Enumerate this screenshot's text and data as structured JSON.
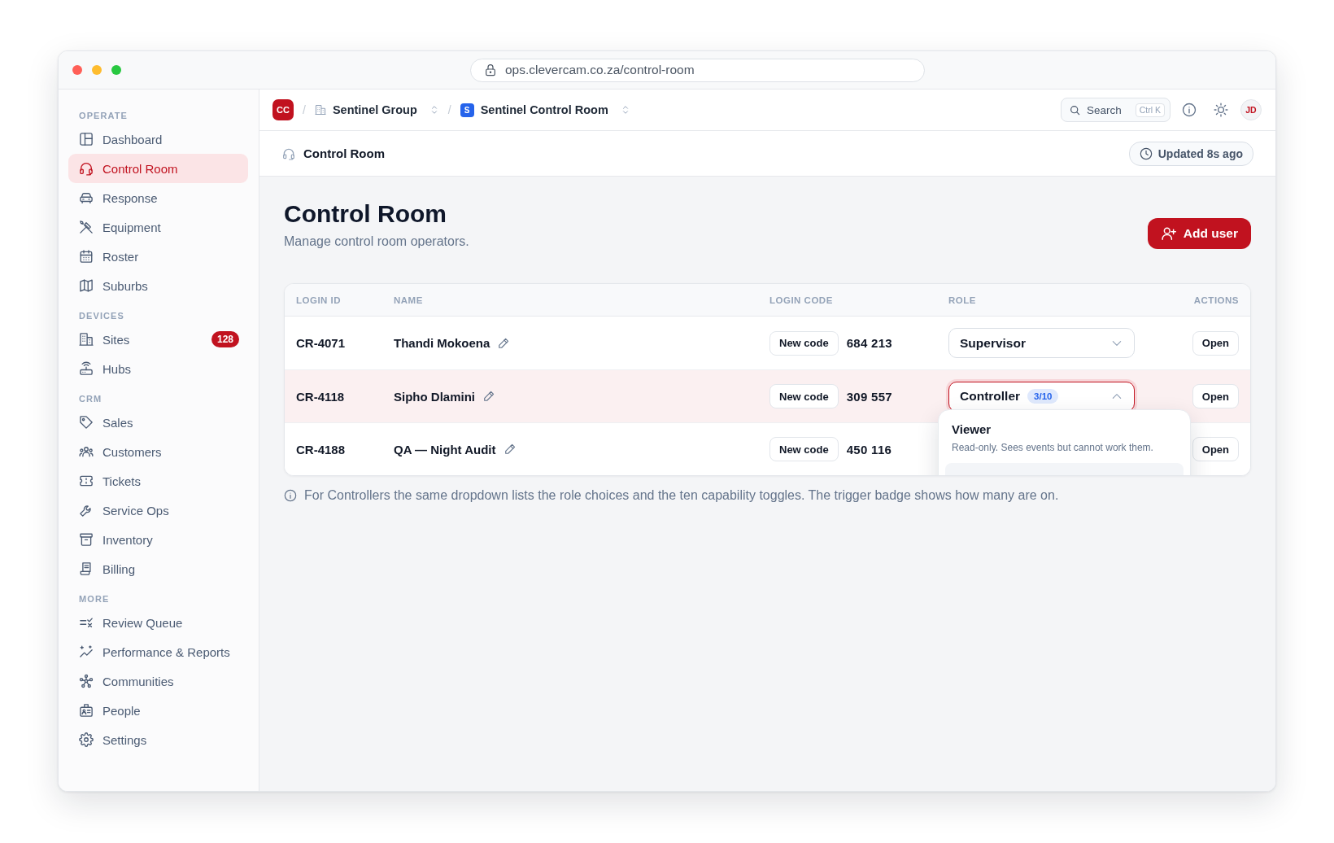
{
  "window": {
    "url": "ops.clevercam.co.za/control-room"
  },
  "sidebar": {
    "sections": [
      {
        "label": "OPERATE",
        "items": [
          {
            "label": "Dashboard",
            "selected": false
          },
          {
            "label": "Control Room",
            "selected": true
          },
          {
            "label": "Response",
            "selected": false
          },
          {
            "label": "Equipment",
            "selected": false
          },
          {
            "label": "Roster",
            "selected": false
          },
          {
            "label": "Suburbs",
            "selected": false
          }
        ]
      },
      {
        "label": "DEVICES",
        "items": [
          {
            "label": "Sites",
            "selected": false,
            "badge": "128"
          },
          {
            "label": "Hubs",
            "selected": false
          }
        ]
      },
      {
        "label": "CRM",
        "items": [
          {
            "label": "Sales",
            "selected": false
          },
          {
            "label": "Customers",
            "selected": false
          },
          {
            "label": "Tickets",
            "selected": false
          },
          {
            "label": "Service Ops",
            "selected": false
          },
          {
            "label": "Inventory",
            "selected": false
          },
          {
            "label": "Billing",
            "selected": false
          }
        ]
      },
      {
        "label": "MORE",
        "items": [
          {
            "label": "Review Queue",
            "selected": false
          },
          {
            "label": "Performance & Reports",
            "selected": false
          },
          {
            "label": "Communities",
            "selected": false
          },
          {
            "label": "People",
            "selected": false
          },
          {
            "label": "Settings",
            "selected": false
          }
        ]
      }
    ]
  },
  "topbar": {
    "org_badge": "CC",
    "breadcrumbs": [
      {
        "separator": "/",
        "label": "Sentinel Group"
      },
      {
        "separator": "/",
        "badge": "S",
        "label": "Sentinel Control Room"
      }
    ],
    "search": {
      "placeholder": "Search",
      "shortcut": "Ctrl K"
    },
    "avatar": "JD"
  },
  "header": {
    "title": "Control Room",
    "updated": "Updated 8s ago"
  },
  "page": {
    "title": "Control Room",
    "subtitle": "Manage control room operators.",
    "add_button": "Add user"
  },
  "table": {
    "columns": [
      "LOGIN ID",
      "NAME",
      "LOGIN CODE",
      "ROLE",
      "ACTIONS"
    ],
    "rows": [
      {
        "login_id": "CR-4071",
        "name": "Thandi Mokoena",
        "new_code": "New code",
        "login_code": "684 213",
        "role": "Supervisor",
        "expanded": false,
        "selected": false,
        "action": "Open"
      },
      {
        "login_id": "CR-4118",
        "name": "Sipho Dlamini",
        "new_code": "New code",
        "login_code": "309 557",
        "role": "Controller",
        "role_badge": "3/10",
        "expanded": true,
        "selected": true,
        "action": "Open",
        "menu": {
          "options": [
            {
              "label": "Viewer",
              "description": "Read-only. Sees events but cannot work them.",
              "selected": false
            },
            {
              "selected": true
            }
          ]
        }
      },
      {
        "login_id": "CR-4188",
        "name": "QA — Night Audit",
        "new_code": "New code",
        "login_code": "450 116",
        "selected": false,
        "action": "Open"
      }
    ]
  },
  "footnote": "For Controllers the same dropdown lists the role choices and the ten capability toggles. The trigger badge shows how many are on."
}
